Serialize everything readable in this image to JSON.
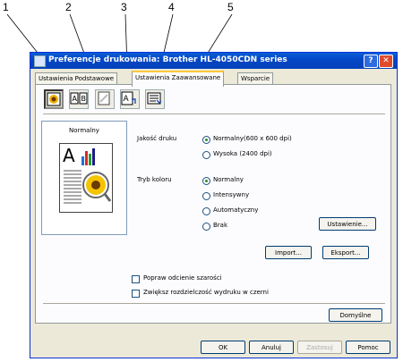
{
  "callouts": [
    "1",
    "2",
    "3",
    "4",
    "5"
  ],
  "window": {
    "title": "Preferencje drukowania: Brother HL-4050CDN series",
    "help_btn": "?",
    "close_btn": "✕"
  },
  "tabs": [
    {
      "label": "Ustawienia Podstawowe"
    },
    {
      "label": "Ustawienia Zaawansowane"
    },
    {
      "label": "Wsparcie"
    }
  ],
  "toolbar_icons": [
    "quality-color-icon",
    "duplex-booklet-icon",
    "watermark-icon",
    "page-setting-icon",
    "device-options-icon"
  ],
  "preview": {
    "label": "Normalny"
  },
  "quality": {
    "label": "Jakość druku",
    "options": [
      "Normalny(600 x 600 dpi)",
      "Wysoka (2400 dpi)"
    ],
    "selected": 0
  },
  "color_mode": {
    "label": "Tryb koloru",
    "options": [
      "Normalny",
      "Intensywny",
      "Automatyczny",
      "Brak"
    ],
    "selected": 0
  },
  "buttons": {
    "settings": "Ustawienie...",
    "import": "Import...",
    "export": "Eksport...",
    "default": "Domyślne",
    "ok": "OK",
    "cancel": "Anuluj",
    "apply": "Zastosuj",
    "help": "Pomoc"
  },
  "checkboxes": [
    {
      "label": "Popraw odcienie szarości",
      "checked": false
    },
    {
      "label": "Zwiększ rozdzielczość wydruku w czerni",
      "checked": false
    }
  ]
}
